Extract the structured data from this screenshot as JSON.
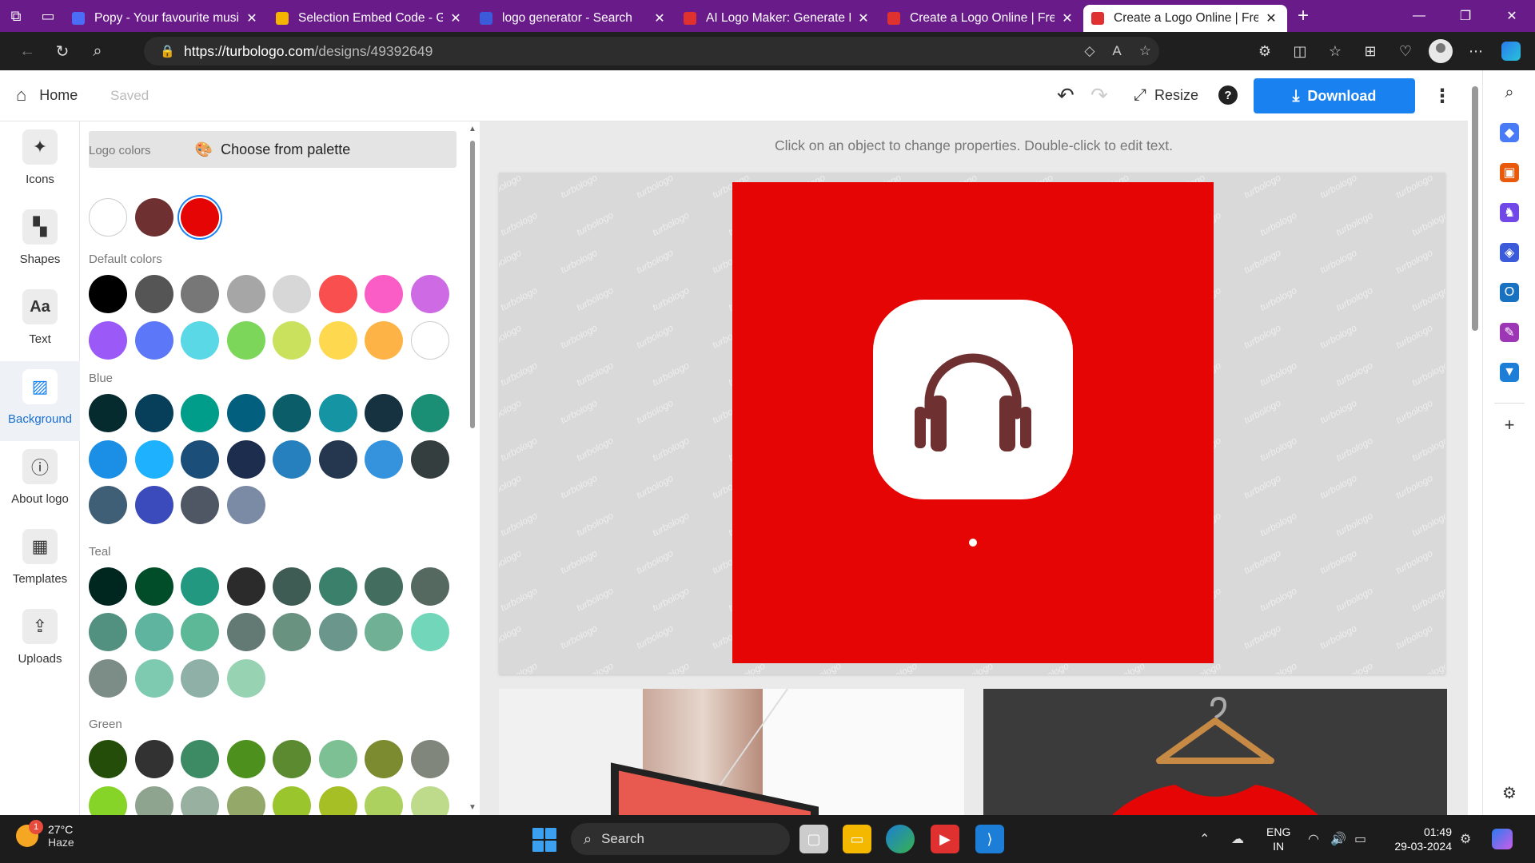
{
  "browser": {
    "tabs": [
      {
        "title": "Popy - Your favourite musi",
        "color": "#4a6cf7",
        "icon": "document-icon"
      },
      {
        "title": "Selection Embed Code - G",
        "color": "#f4b400",
        "icon": "slides-icon"
      },
      {
        "title": "logo generator - Search",
        "color": "#3b5bdb",
        "icon": "search-icon"
      },
      {
        "title": "AI Logo Maker: Generate F",
        "color": "#e03131",
        "icon": "turbologo-icon"
      },
      {
        "title": "Create a Logo Online | Fre",
        "color": "#e03131",
        "icon": "turbologo-icon"
      },
      {
        "title": "Create a Logo Online | Fre",
        "color": "#e03131",
        "icon": "turbologo-icon"
      }
    ],
    "url": {
      "host": "https://turbologo.com",
      "path": "/designs/49392649"
    }
  },
  "header": {
    "home_label": "Home",
    "saved_label": "Saved",
    "resize_label": "Resize",
    "help_label": "?",
    "download_label": "Download"
  },
  "rail": [
    {
      "label": "Icons",
      "icon": "sparkle-icon"
    },
    {
      "label": "Shapes",
      "icon": "shapes-icon"
    },
    {
      "label": "Text",
      "icon": "text-icon"
    },
    {
      "label": "Background",
      "icon": "background-icon"
    },
    {
      "label": "About logo",
      "icon": "info-icon"
    },
    {
      "label": "Templates",
      "icon": "templates-icon"
    },
    {
      "label": "Uploads",
      "icon": "upload-icon"
    }
  ],
  "panel": {
    "palette_button": "Choose from palette",
    "logo_colors_title": "Logo colors",
    "logo_colors": [
      "#ffffff",
      "#6e3030",
      "#e50505"
    ],
    "selected_color": "#e50505",
    "default_title": "Default colors",
    "default_colors": [
      "#000000",
      "#555555",
      "#777777",
      "#a6a6a6",
      "#d7d7d7",
      "#f9504f",
      "#fb5dc6",
      "#cd6ae4",
      "#9b5af7",
      "#5c78f9",
      "#5ad8e6",
      "#7bd659",
      "#c9e15d",
      "#fed84f",
      "#feb347",
      "#ffffff"
    ],
    "blue_title": "Blue",
    "blue_colors": [
      "#052b2f",
      "#073f5a",
      "#009d8a",
      "#025f7d",
      "#0b5d6a",
      "#1595a3",
      "#163140",
      "#1a8f75",
      "#1b8fe5",
      "#1eb1fe",
      "#1b4e78",
      "#1c2d4e",
      "#2780be",
      "#24374f",
      "#3593de",
      "#353e3f",
      "#3e5f75",
      "#3c4bbc",
      "#4e5763",
      "#7b8aa5"
    ],
    "teal_title": "Teal",
    "teal_colors": [
      "#002620",
      "#014d2a",
      "#229880",
      "#2b2b2b",
      "#3f5c54",
      "#3b806b",
      "#426d5f",
      "#556960",
      "#52907f",
      "#5fb4a0",
      "#5db898",
      "#637a74",
      "#6a9280",
      "#6b968c",
      "#70b195",
      "#72d6bb",
      "#7c8c86",
      "#7dcab1",
      "#8fb0a7",
      "#97d3b3"
    ],
    "green_title": "Green",
    "green_colors": [
      "#254d0a",
      "#313231",
      "#3d8b65",
      "#4d901e",
      "#5b8a30",
      "#7cc093",
      "#7c8b2f",
      "#80867c",
      "#86d427",
      "#8fa48f",
      "#97b0a0",
      "#94a969",
      "#9bc52d",
      "#a5bf25",
      "#add15e",
      "#bddb8b"
    ]
  },
  "canvas": {
    "hint": "Click on an object to change properties. Double-click to edit text.",
    "watermark": "turbologo",
    "background_color": "#e50505",
    "icon_color": "#6e3030",
    "icon": "headphones-icon"
  },
  "taskbar": {
    "temp": "27°C",
    "weather": "Haze",
    "badge": "1",
    "search_label": "Search",
    "lang1": "ENG",
    "lang2": "IN",
    "time": "01:49",
    "date": "29-03-2024"
  }
}
